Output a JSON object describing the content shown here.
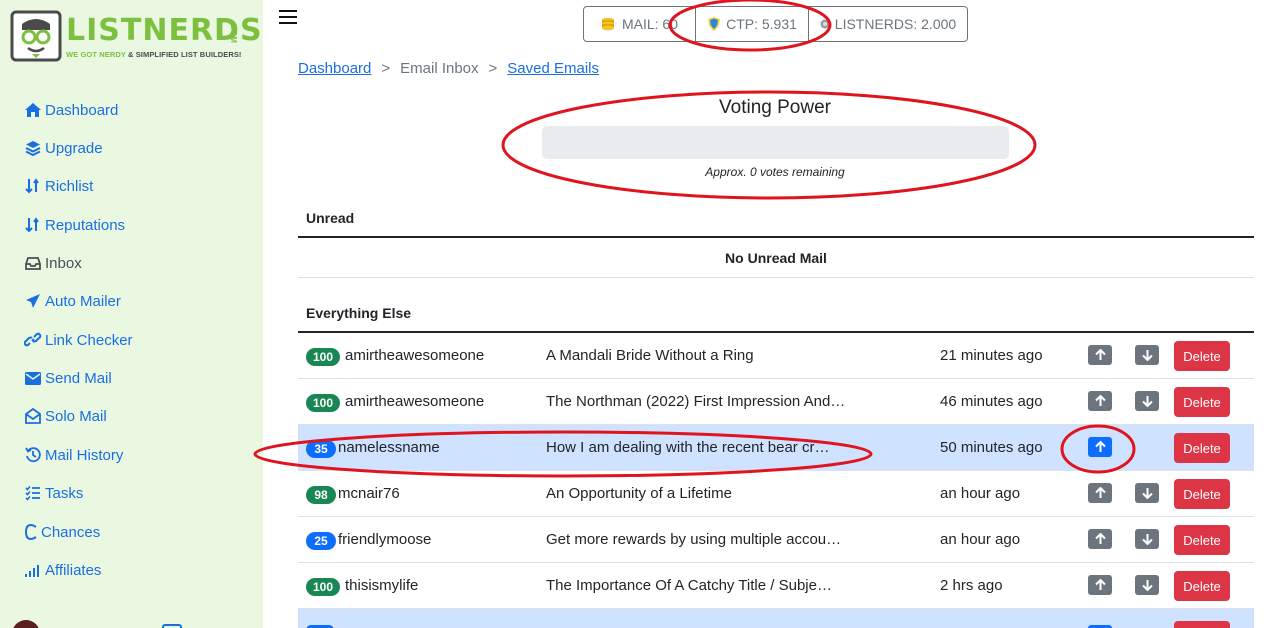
{
  "logo": {
    "brand": "LISTNERDS",
    "com": ".COM",
    "tagline_a": "WE GOT NERDY ",
    "tagline_b": "& SIMPLIFIED LIST BUILDERS!"
  },
  "sidebar": {
    "items": [
      {
        "label": "Dashboard",
        "icon": "home-icon"
      },
      {
        "label": "Upgrade",
        "icon": "layers-icon"
      },
      {
        "label": "Richlist",
        "icon": "sort-icon"
      },
      {
        "label": "Reputations",
        "icon": "sort-icon"
      },
      {
        "label": "Inbox",
        "icon": "inbox-icon"
      },
      {
        "label": "Auto Mailer",
        "icon": "send-icon"
      },
      {
        "label": "Link Checker",
        "icon": "link-icon"
      },
      {
        "label": "Send Mail",
        "icon": "envelope-icon"
      },
      {
        "label": "Solo Mail",
        "icon": "envelope-open-icon"
      },
      {
        "label": "Mail History",
        "icon": "history-icon"
      },
      {
        "label": "Tasks",
        "icon": "tasks-icon"
      },
      {
        "label": "Chances",
        "icon": "c-icon"
      },
      {
        "label": "Affiliates",
        "icon": "signal-icon"
      }
    ]
  },
  "balances": {
    "mail": "MAIL: 6",
    "mail_tail": "0",
    "ctp": "CTP: 5.931",
    "listnerds": "LISTNERDS: 2.000"
  },
  "breadcrumb": {
    "dashboard": "Dashboard",
    "sep": ">",
    "inbox": "Email Inbox",
    "saved": "Saved Emails"
  },
  "voting": {
    "title": "Voting Power",
    "note": "Approx. 0 votes remaining",
    "level": 0
  },
  "unread": {
    "title": "Unread",
    "empty": "No Unread Mail"
  },
  "everything_else": {
    "title": "Everything Else",
    "delete_label": "Delete",
    "rows": [
      {
        "score": "100",
        "badge": "green",
        "sender": "amirtheawesomeone",
        "subject": "A Mandali Bride Without a Ring",
        "time": "21 minutes ago",
        "voted": false
      },
      {
        "score": "100",
        "badge": "green",
        "sender": "amirtheawesomeone",
        "subject": "The Northman (2022) First Impression And…",
        "time": "46 minutes ago",
        "voted": false
      },
      {
        "score": "35",
        "badge": "blue",
        "sender": "namelessname",
        "subject": "How I am dealing with the recent bear cr…",
        "time": "50 minutes ago",
        "voted": true
      },
      {
        "score": "98",
        "badge": "green",
        "sender": "mcnair76",
        "subject": "An Opportunity of a Lifetime",
        "time": "an hour ago",
        "voted": false
      },
      {
        "score": "25",
        "badge": "blue",
        "sender": "friendlymoose",
        "subject": "Get more rewards by using multiple accou…",
        "time": "an hour ago",
        "voted": false
      },
      {
        "score": "100",
        "badge": "green",
        "sender": "thisismylife",
        "subject": "The Importance Of A Catchy Title / Subje…",
        "time": "2 hrs ago",
        "voted": false
      }
    ]
  },
  "colors": {
    "sidebar_bg": "#eaf8e2",
    "link": "#1a6fe0",
    "brand_green": "#7dbf3e",
    "highlight_row": "#cfe2ff",
    "delete": "#dc3545",
    "annotation": "#e0141e"
  }
}
